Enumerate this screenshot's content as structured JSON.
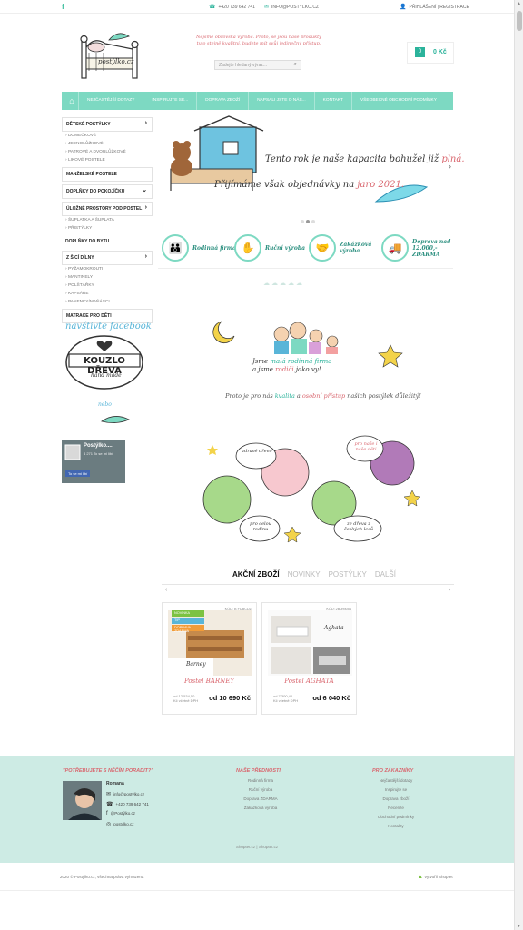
{
  "topbar": {
    "facebook": "f",
    "phone": "+420 739 642 741",
    "email": "INFO@POSTYLKO.CZ",
    "login": "PŘIHLÁŠENÍ | REGISTRACE"
  },
  "header": {
    "logo_text": "postýlko.cz",
    "slogan": "Nejsme obrovská výroba. Proto, se jsou naše produkty tyto stejně kvalitní, budete mít svůj jedinečný přístup.",
    "search_placeholder": "Zadejte hledaný výraz...",
    "cart_count": "0",
    "cart_amount": "0 Kč"
  },
  "nav": {
    "items": [
      "NEJČASTĚJŠÍ DOTAZY",
      "INSPIRUJTE SE...",
      "DOPRAVA ZBOŽÍ",
      "NAPSALI JSTE O NÁS...",
      "KONTAKT",
      "VŠEOBECNÉ OBCHODNÍ PODMÍNKY"
    ]
  },
  "sidebar": {
    "c1": "DĚTSKÉ POSTÝLKY",
    "c1_subs": [
      "DOMEČKOVÉ",
      "JEDNOLŮŽKOVÉ",
      "PATROVÉ A DVOULŮŽKOVÉ",
      "LIKOVÉ POSTELE"
    ],
    "c2": "MANŽELSKÉ POSTELE",
    "c3": "DOPLŇKY DO POKOJÍČKU",
    "c4": "ÚLOŽNÉ PROSTORY POD POSTEL",
    "c4_subs": [
      "ŠUPLATKA A ŠUPLATA",
      "PŘISTÝLKY"
    ],
    "c5": "DOPLŇKY DO BYTU",
    "c6": "Z ŠICÍ DÍLNY",
    "c6_subs": [
      "PYŽAMOKROUTI",
      "MANTINELY",
      "POLŠTÁŘKY",
      "KAPSÁŘE",
      "PANENKY/MAŇÁSCI"
    ],
    "c7": "MATRACE PRO DĚTI",
    "fb_title": "navštivte facebook",
    "kouzlo": "KOUZLO DŘEVA",
    "handmade": "hand made",
    "nebo": "nebo",
    "widget_name": "Postýlko....",
    "widget_likes": "4 271 To se mi líbí",
    "widget_like_btn": "To se mi líbí"
  },
  "slider": {
    "line1": "Tento rok je naše kapacita bohužel již",
    "line1_em": "plná.",
    "line2": "Přijímáme však objednávky na",
    "line2_em": "jaro 2021."
  },
  "features": [
    {
      "icon": "family-icon",
      "label": "Rodinná firma"
    },
    {
      "icon": "hand-icon",
      "label": "Ruční výroba"
    },
    {
      "icon": "handshake-icon",
      "label": "Zakázková výroba"
    },
    {
      "icon": "truck-icon",
      "label": "Doprava nad 12.000,- ZDARMA"
    }
  ],
  "family": {
    "l1a": "Jsme ",
    "l1b": "malá",
    "l1c": " rodinná firma",
    "l2a": "a jsme ",
    "l2b": "rodiči",
    "l2c": " jako vy!",
    "tag_a": "Proto je pro nás ",
    "tag_b": "kvalita",
    "tag_c": " a ",
    "tag_d": "osobní přístup",
    "tag_e": " našich postýlek důležitý!"
  },
  "bubbles": {
    "b1": "zdravé dřevo",
    "b2": "pro naše i naše děti",
    "b3": "pro celou rodinu",
    "b4": "ze dřeva z českých lesů"
  },
  "products": {
    "tabs": [
      "AKČNÍ ZBOŽÍ",
      "NOVINKY",
      "POSTÝLKY",
      "DALŠÍ"
    ],
    "items": [
      {
        "code": "KÓD: B FUBCDZ",
        "name": "Postel BARNEY",
        "old_line1": "od 12 534,50",
        "old_line2": "Kč včetně DPH",
        "price": "od 10 690 Kč",
        "badges": [
          "NOVINKA",
          "TIP",
          "DOPRAVA ZDARMA"
        ],
        "img_label": "Barney"
      },
      {
        "code": "KÓD: 2B0/M054",
        "name": "Postel AGHATA",
        "old_line1": "od 7 300,40",
        "old_line2": "Kč včetně DPH",
        "price": "od 6 040 Kč",
        "badges": [],
        "img_label": "Aghata"
      }
    ]
  },
  "footer": {
    "col1_title": "\"POTŘEBUJETE S NĚČÍM PORADIT?\"",
    "contact_name": "Romana",
    "contact_email": "info@postylko.cz",
    "contact_phone": "+420 739 642 741",
    "contact_fb": "@Postýlko.cz",
    "contact_ig": "postylko.cz",
    "col2_title": "NAŠE PŘEDNOSTI",
    "col2_links": [
      "Rodinná firma",
      "Ruční výroba",
      "Doprava ZDARMA",
      "Zakázková výroba"
    ],
    "col3_title": "PRO ZÁKAZNÍKY",
    "col3_links": [
      "Nejčastější dotazy",
      "Inspirujte se",
      "Doprava zboží",
      "Recenze",
      "Obchodní podmínky",
      "Kontakty"
    ],
    "shop_links": "Shoptet.cz | Shoptet.cz",
    "copyright": "2020 © Postýlko.cz, všechna práva vyhrazena",
    "made": "Vytvořil Shoptet"
  }
}
